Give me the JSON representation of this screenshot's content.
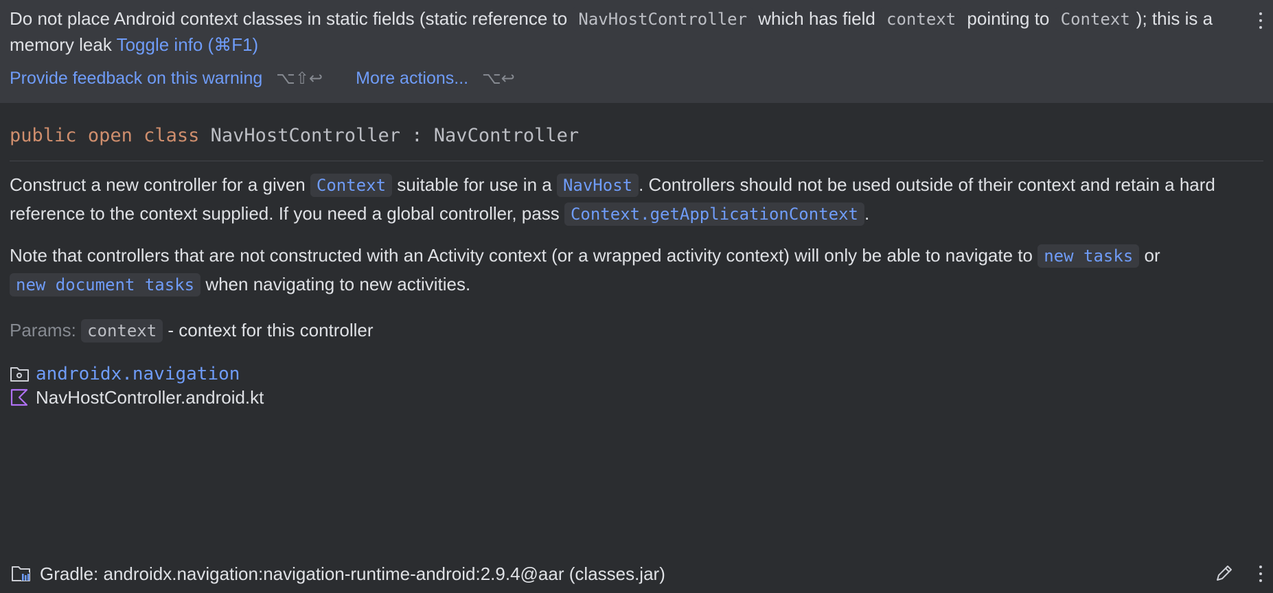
{
  "warning": {
    "text_1": "Do not place Android context classes in static fields (static reference to ",
    "code_1": "NavHostController",
    "text_2": " which has field ",
    "code_2": "context",
    "text_3": " pointing to ",
    "code_3": "Context",
    "text_4": "); this is a memory leak ",
    "toggle_link": "Toggle info (⌘F1)",
    "feedback_link": "Provide feedback on this warning",
    "feedback_shortcut": "⌥⇧↩",
    "more_actions_link": "More actions...",
    "more_actions_shortcut": "⌥↩"
  },
  "signature": {
    "kw_public": "public",
    "kw_open": "open",
    "kw_class": "class",
    "class_name": "NavHostController",
    "separator": ":",
    "super_class": "NavController"
  },
  "doc": {
    "p1_t1": "Construct a new controller for a given ",
    "p1_c1": "Context",
    "p1_t2": " suitable for use in a ",
    "p1_c2": "NavHost",
    "p1_t3": ". Controllers should not be used outside of their context and retain a hard reference to the context supplied. If you need a global controller, pass ",
    "p1_c3": "Context.getApplicationContext",
    "p1_t4": ".",
    "p2_t1": "Note that controllers that are not constructed with an Activity context (or a wrapped activity context) will only be able to navigate to ",
    "p2_c1": "new tasks",
    "p2_t2": " or ",
    "p2_c2": "new document tasks",
    "p2_t3": " when navigating to new activities.",
    "params_label": "Params:",
    "param_name": "context",
    "param_desc": " - context for this controller"
  },
  "location": {
    "package": "androidx.navigation",
    "file": "NavHostController.android.kt"
  },
  "footer": {
    "library": "Gradle: androidx.navigation:navigation-runtime-android:2.9.4@aar (classes.jar)"
  },
  "colors": {
    "background": "#2b2d30",
    "header_background": "#393b40",
    "link": "#6f9cf8",
    "keyword": "#cf8e6d",
    "kotlin_icon": "#b072f5"
  },
  "icons": [
    "kebab-menu-icon",
    "folder-package-icon",
    "kotlin-file-icon",
    "library-folder-icon",
    "pencil-edit-icon"
  ]
}
